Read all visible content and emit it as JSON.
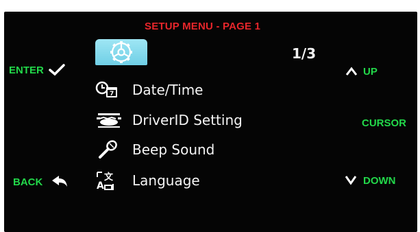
{
  "header": {
    "title": "SETUP MENU - PAGE 1"
  },
  "page_indicator": "1/3",
  "tab": {
    "icon": "settings-gear-icon",
    "color": "#8fdcee"
  },
  "menu": {
    "items": [
      {
        "label": "Date/Time",
        "icon": "clock-calendar-icon"
      },
      {
        "label": "DriverID Setting",
        "icon": "driver-id-icon"
      },
      {
        "label": "Beep Sound",
        "icon": "microphone-icon"
      },
      {
        "label": "Language",
        "icon": "language-icon"
      }
    ]
  },
  "left_controls": {
    "enter": {
      "label": "ENTER",
      "icon": "checkmark-icon"
    },
    "back": {
      "label": "BACK",
      "icon": "back-arrow-icon"
    }
  },
  "right_controls": {
    "up": {
      "label": "UP",
      "icon": "caret-up-icon"
    },
    "cursor": {
      "label": "CURSOR"
    },
    "down": {
      "label": "DOWN",
      "icon": "caret-down-icon"
    }
  },
  "colors": {
    "title": "#e8262b",
    "controls": "#22d84a",
    "text": "#f4f4f4",
    "background": "#050505"
  }
}
